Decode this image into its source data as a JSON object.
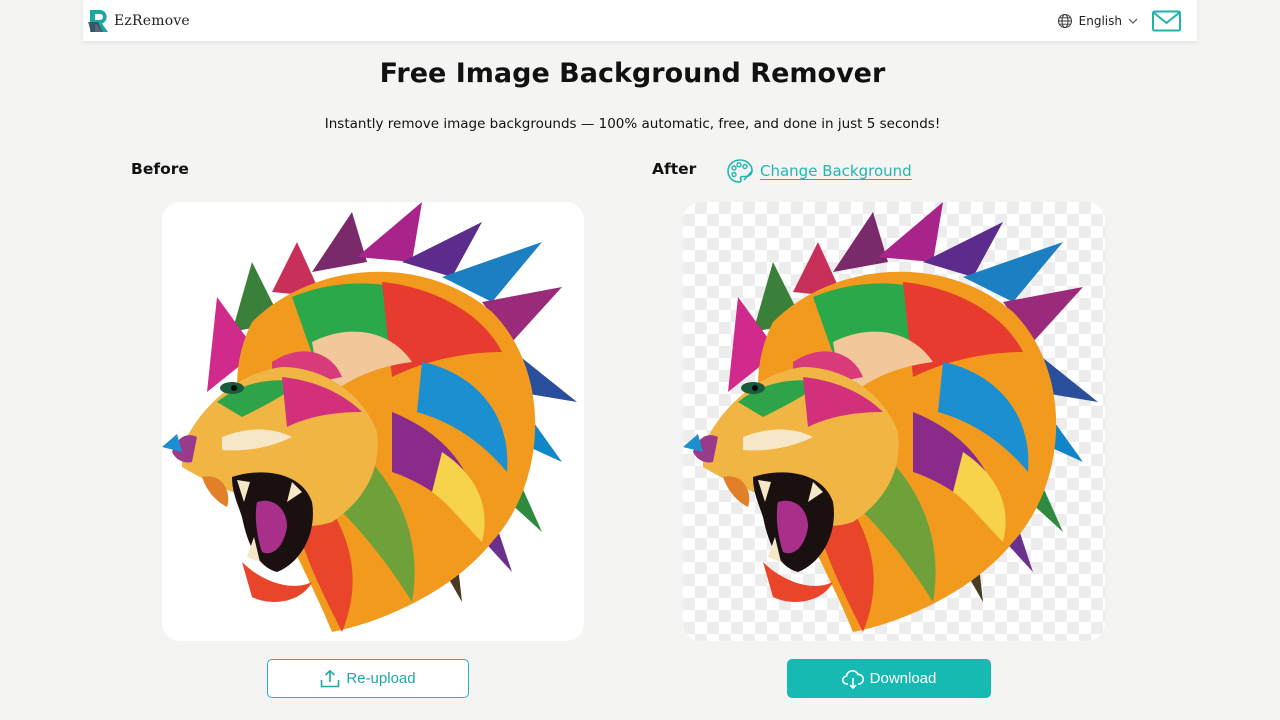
{
  "brand": {
    "name": "EzRemove",
    "logo_icon": "ezremove-logo-icon"
  },
  "header": {
    "language": "English",
    "language_icon": "globe-icon",
    "mail_icon": "mail-icon"
  },
  "hero": {
    "title": "Free Image Background Remover",
    "subtitle": "Instantly remove image backgrounds — 100% automatic, free, and done in just 5 seconds!"
  },
  "before": {
    "label": "Before"
  },
  "after": {
    "label": "After",
    "change_background": "Change Background",
    "palette_icon": "palette-icon"
  },
  "actions": {
    "reupload": "Re-upload",
    "download": "Download"
  },
  "colors": {
    "accent": "#17b9b3",
    "page_bg": "#f4f4f3",
    "checker": "#ededed"
  }
}
